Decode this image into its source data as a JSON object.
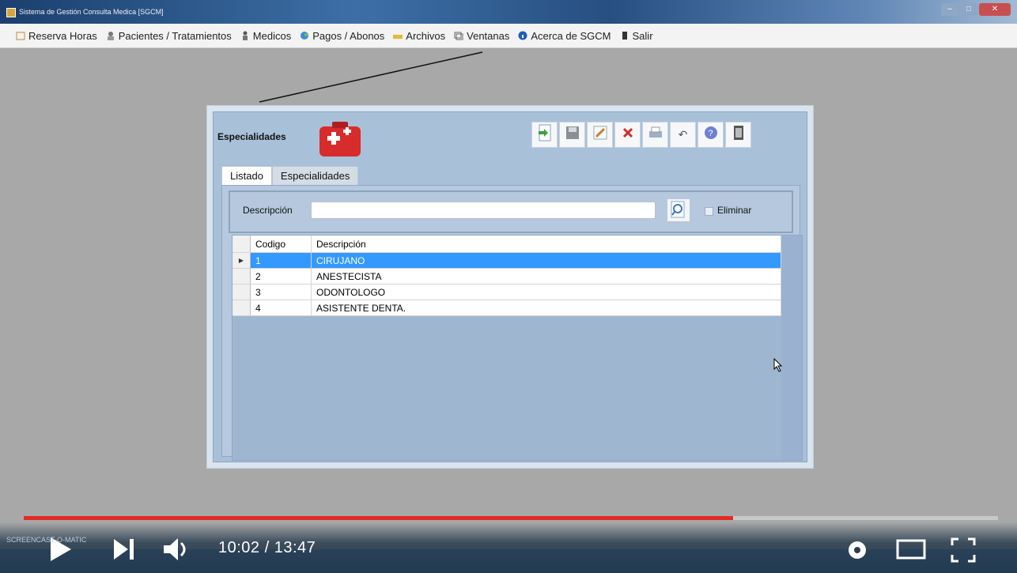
{
  "window": {
    "title": "Sistema de Gestión Consulta Medica [SGCM]"
  },
  "menu": [
    {
      "label": "Reserva Horas",
      "icon": "calendar-icon"
    },
    {
      "label": "Pacientes / Tratamientos",
      "icon": "patients-icon"
    },
    {
      "label": "Medicos",
      "icon": "doctor-icon"
    },
    {
      "label": "Pagos / Abonos",
      "icon": "payments-icon"
    },
    {
      "label": "Archivos",
      "icon": "folder-icon"
    },
    {
      "label": "Ventanas",
      "icon": "windows-icon"
    },
    {
      "label": "Acerca de SGCM",
      "icon": "info-icon"
    },
    {
      "label": "Salir",
      "icon": "exit-icon"
    }
  ],
  "form": {
    "title": "Especialidades",
    "toolbar": [
      "new-icon",
      "save-icon",
      "edit-icon",
      "delete-icon",
      "print-icon",
      "undo-icon",
      "help-icon",
      "close-icon"
    ],
    "tabs": {
      "listado": "Listado",
      "especialidades": "Especialidades"
    },
    "search": {
      "label": "Descripción",
      "value": "",
      "checkbox_label": "Eliminar"
    },
    "grid": {
      "columns": [
        "Codigo",
        "Descripción"
      ],
      "rows": [
        {
          "codigo": "1",
          "descripcion": "CIRUJANO",
          "selected": true
        },
        {
          "codigo": "2",
          "descripcion": "ANESTECISTA"
        },
        {
          "codigo": "3",
          "descripcion": "ODONTOLOGO"
        },
        {
          "codigo": "4",
          "descripcion": "ASISTENTE DENTA."
        }
      ]
    }
  },
  "player": {
    "time": "10:02 / 13:47",
    "progress": 0.728,
    "watermark": "SCREENCAST-O-MATIC"
  },
  "colors": {
    "selection": "#3399ff",
    "progress": "#e32b25"
  }
}
